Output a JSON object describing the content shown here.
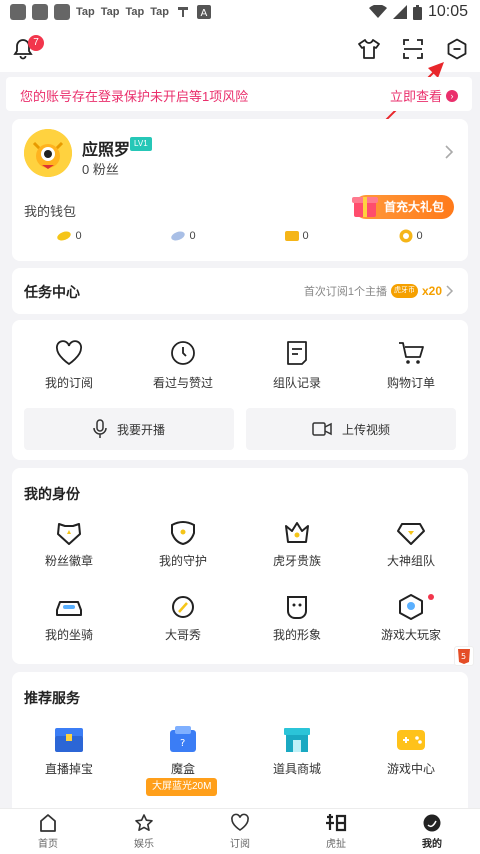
{
  "status_bar": {
    "tap_labels": [
      "Tap",
      "Tap",
      "Tap",
      "Tap"
    ],
    "time": "10:05"
  },
  "header": {
    "notification_count": "7"
  },
  "alert": {
    "text": "您的账号存在登录保护未开启等1项风险",
    "link": "立即查看"
  },
  "profile": {
    "username": "应照罗",
    "level": "LV1",
    "fans": "0 粉丝",
    "wallet_label": "我的钱包",
    "gift_label": "首充大礼包",
    "coins": [
      "0",
      "0",
      "0",
      "0"
    ]
  },
  "task": {
    "title": "任务中心",
    "hint": "首次订阅1个主播",
    "reward_badge": "虎牙币",
    "reward": "x20"
  },
  "quick": {
    "items": [
      "我的订阅",
      "看过与赞过",
      "组队记录",
      "购物订单"
    ],
    "broadcast": "我要开播",
    "upload": "上传视频"
  },
  "identity": {
    "title": "我的身份",
    "row1": [
      "粉丝徽章",
      "我的守护",
      "虎牙贵族",
      "大神组队"
    ],
    "row2": [
      "我的坐骑",
      "大哥秀",
      "我的形象",
      "游戏大玩家"
    ]
  },
  "services": {
    "title": "推荐服务",
    "items": [
      "直播掉宝",
      "魔盒",
      "道具商城",
      "游戏中心"
    ],
    "promo_badge": "大屏蓝光20M"
  },
  "tabbar": {
    "items": [
      "首页",
      "娱乐",
      "订阅",
      "虎扯",
      "我的"
    ],
    "active": "我的"
  },
  "colors": {
    "accent_red": "#f2364c",
    "alert_pink": "#ea2f6c",
    "gift_orange": "#ff7a1a",
    "service_blue": "#3b7df5"
  }
}
